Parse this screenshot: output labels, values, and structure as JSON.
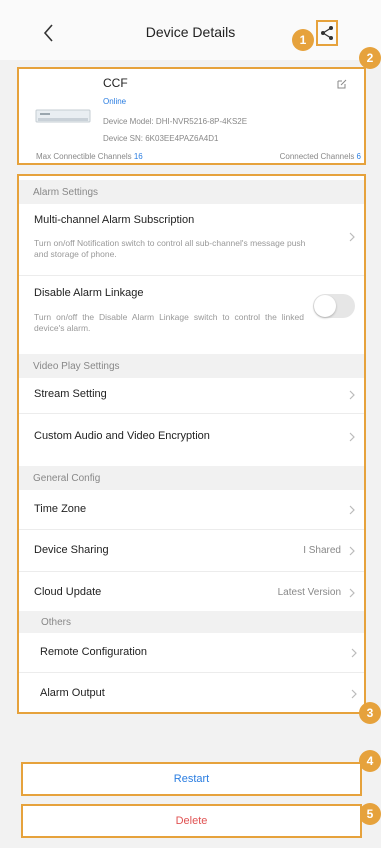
{
  "header": {
    "title": "Device Details"
  },
  "callouts": [
    "1",
    "2",
    "3",
    "4",
    "5"
  ],
  "device": {
    "name": "CCF",
    "status": "Online",
    "model": "Device Model:  DHI-NVR5216-8P-4KS2E",
    "sn": "Device SN:  6K03EE4PAZ6A4D1",
    "max_channels_label": "Max Connectible Channels",
    "max_channels_value": "16",
    "connected_channels_label": "Connected Channels",
    "connected_channels_value": "6"
  },
  "sections": {
    "alarm": "Alarm Settings",
    "video": "Video Play Settings",
    "general": "General Config",
    "others": "Others"
  },
  "rows": {
    "multi_channel_title": "Multi-channel Alarm Subscription",
    "multi_channel_desc": "Turn on/off Notification switch to control all sub-channel's message push and storage of phone.",
    "disable_linkage_title": "Disable Alarm Linkage",
    "disable_linkage_desc": "Turn on/off the Disable Alarm Linkage switch to control the linked device's alarm.",
    "disable_linkage_on": false,
    "stream_setting": "Stream Setting",
    "encryption": "Custom Audio and Video Encryption",
    "time_zone": "Time Zone",
    "device_sharing": "Device Sharing",
    "device_sharing_value": "I Shared",
    "cloud_update": "Cloud Update",
    "cloud_update_value": "Latest Version",
    "remote_config": "Remote Configuration",
    "alarm_output": "Alarm Output"
  },
  "buttons": {
    "restart": "Restart",
    "delete": "Delete"
  },
  "colors": {
    "accent": "#e6a23c",
    "link": "#2a7de1",
    "danger": "#e05252"
  }
}
